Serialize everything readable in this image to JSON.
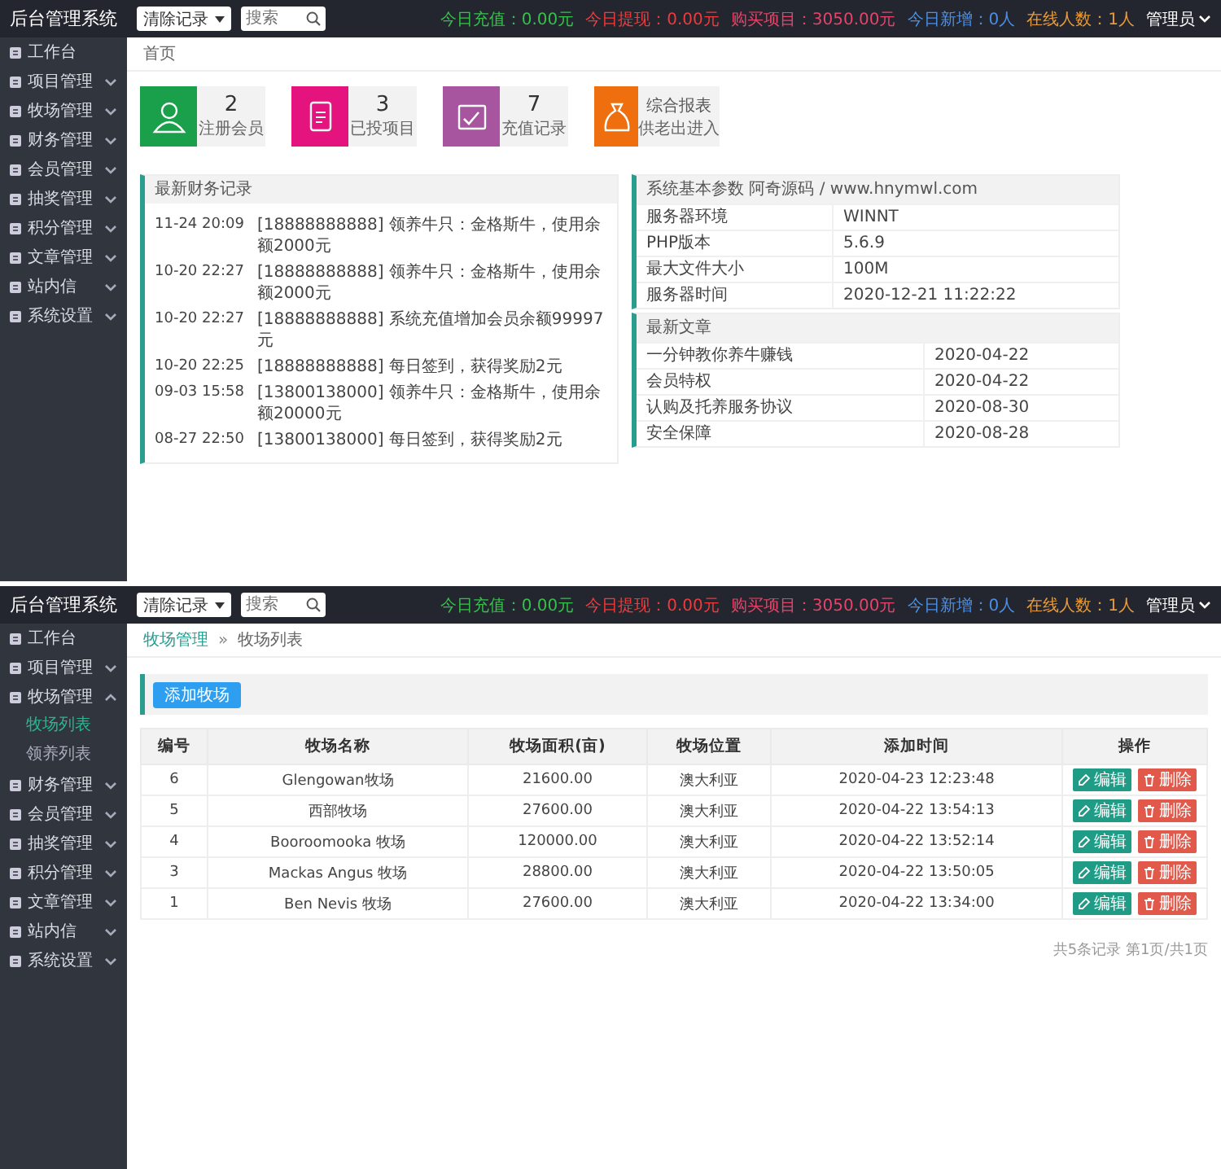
{
  "screens": [
    {
      "kind": "dashboard",
      "app_title": "后台管理系统",
      "record_select": "清除记录",
      "search": {
        "placeholder": "搜索"
      },
      "stats": [
        {
          "text": "今日充值：0.00元",
          "color": "#35c24a"
        },
        {
          "text": "今日提现：0.00元",
          "color": "#f23a3a"
        },
        {
          "text": "购买项目：3050.00元",
          "color": "#e8436a"
        },
        {
          "text": "今日新增：0人",
          "color": "#4a8fe8"
        },
        {
          "text": "在线人数：1人",
          "color": "#e89a3a"
        }
      ],
      "user_menu": "管理员",
      "sidebar": [
        {
          "label": "工作台"
        },
        {
          "label": "项目管理",
          "expanded": false
        },
        {
          "label": "牧场管理",
          "expanded": false
        },
        {
          "label": "财务管理",
          "expanded": false
        },
        {
          "label": "会员管理",
          "expanded": false
        },
        {
          "label": "抽奖管理",
          "expanded": false
        },
        {
          "label": "积分管理",
          "expanded": false
        },
        {
          "label": "文章管理",
          "expanded": false
        },
        {
          "label": "站内信",
          "expanded": false
        },
        {
          "label": "系统设置",
          "expanded": false
        }
      ],
      "breadcrumb": [
        "首页"
      ],
      "cards": [
        {
          "count": "2",
          "label": "注册会员",
          "color": "#1aa04a"
        },
        {
          "count": "3",
          "label": "已投项目",
          "color": "#e5137e"
        },
        {
          "count": "7",
          "label": "充值记录",
          "color": "#a8559f"
        },
        {
          "title": "综合报表",
          "label": "供老出进入",
          "color": "#ef6f0e"
        }
      ],
      "finance": {
        "title": "最新财务记录",
        "records": [
          {
            "time": "11-24 20:09",
            "text": "[18888888888] 领养牛只：金格斯牛，使用余额2000元"
          },
          {
            "time": "10-20 22:27",
            "text": "[18888888888] 领养牛只：金格斯牛，使用余额2000元"
          },
          {
            "time": "10-20 22:27",
            "text": "[18888888888] 系统充值增加会员余额99997元"
          },
          {
            "time": "10-20 22:25",
            "text": "[18888888888] 每日签到，获得奖励2元"
          },
          {
            "time": "09-03 15:58",
            "text": "[13800138000] 领养牛只：金格斯牛，使用余额20000元"
          },
          {
            "time": "08-27 22:50",
            "text": "[13800138000] 每日签到，获得奖励2元"
          }
        ]
      },
      "system": {
        "title": "系统基本参数 阿奇源码 / www.hnymwl.com",
        "rows": [
          {
            "name": "服务器环境",
            "value": "WINNT"
          },
          {
            "name": "PHP版本",
            "value": "5.6.9"
          },
          {
            "name": "最大文件大小",
            "value": "100M"
          },
          {
            "name": "服务器时间",
            "value": "2020-12-21 11:22:22"
          }
        ]
      },
      "articles": {
        "title": "最新文章",
        "rows": [
          {
            "title": "一分钟教你养牛赚钱",
            "date": "2020-04-22"
          },
          {
            "title": "会员特权",
            "date": "2020-04-22"
          },
          {
            "title": "认购及托养服务协议",
            "date": "2020-08-30"
          },
          {
            "title": "安全保障",
            "date": "2020-08-28"
          }
        ]
      }
    },
    {
      "kind": "list",
      "app_title": "后台管理系统",
      "record_select": "清除记录",
      "search": {
        "placeholder": "搜索"
      },
      "stats": [
        {
          "text": "今日充值：0.00元",
          "color": "#35c24a"
        },
        {
          "text": "今日提现：0.00元",
          "color": "#f23a3a"
        },
        {
          "text": "购买项目：3050.00元",
          "color": "#e8436a"
        },
        {
          "text": "今日新增：0人",
          "color": "#4a8fe8"
        },
        {
          "text": "在线人数：1人",
          "color": "#e89a3a"
        }
      ],
      "user_menu": "管理员",
      "sidebar": [
        {
          "label": "工作台"
        },
        {
          "label": "项目管理",
          "expanded": false
        },
        {
          "label": "牧场管理",
          "expanded": true,
          "children": [
            {
              "label": "牧场列表",
              "selected": true
            },
            {
              "label": "领养列表",
              "selected": false
            }
          ]
        },
        {
          "label": "财务管理",
          "expanded": false
        },
        {
          "label": "会员管理",
          "expanded": false
        },
        {
          "label": "抽奖管理",
          "expanded": false
        },
        {
          "label": "积分管理",
          "expanded": false
        },
        {
          "label": "文章管理",
          "expanded": false
        },
        {
          "label": "站内信",
          "expanded": false
        },
        {
          "label": "系统设置",
          "expanded": false
        }
      ],
      "breadcrumb": [
        "牧场管理",
        "牧场列表"
      ],
      "breadcrumb_separator": "»",
      "add_button": "添加牧场",
      "table": {
        "columns": [
          "编号",
          "牧场名称",
          "牧场面积(亩)",
          "牧场位置",
          "添加时间",
          "操作"
        ],
        "rows": [
          {
            "cells": [
              "6",
              "Glengowan牧场",
              "21600.00",
              "澳大利亚",
              "2020-04-23 12:23:48"
            ],
            "actions": [
              {
                "kind": "edit",
                "label": "编辑"
              },
              {
                "kind": "delete",
                "label": "删除"
              }
            ]
          },
          {
            "cells": [
              "5",
              "西部牧场",
              "27600.00",
              "澳大利亚",
              "2020-04-22 13:54:13"
            ],
            "actions": [
              {
                "kind": "edit",
                "label": "编辑"
              },
              {
                "kind": "delete",
                "label": "删除"
              }
            ]
          },
          {
            "cells": [
              "4",
              "Booroomooka 牧场",
              "120000.00",
              "澳大利亚",
              "2020-04-22 13:52:14"
            ],
            "actions": [
              {
                "kind": "edit",
                "label": "编辑"
              },
              {
                "kind": "delete",
                "label": "删除"
              }
            ]
          },
          {
            "cells": [
              "3",
              "Mackas Angus 牧场",
              "28800.00",
              "澳大利亚",
              "2020-04-22 13:50:05"
            ],
            "actions": [
              {
                "kind": "edit",
                "label": "编辑"
              },
              {
                "kind": "delete",
                "label": "删除"
              }
            ]
          },
          {
            "cells": [
              "1",
              "Ben Nevis 牧场",
              "27600.00",
              "澳大利亚",
              "2020-04-22 13:34:00"
            ],
            "actions": [
              {
                "kind": "edit",
                "label": "编辑"
              },
              {
                "kind": "delete",
                "label": "删除"
              }
            ]
          }
        ]
      },
      "pagination": "共5条记录 第1页/共1页"
    }
  ]
}
